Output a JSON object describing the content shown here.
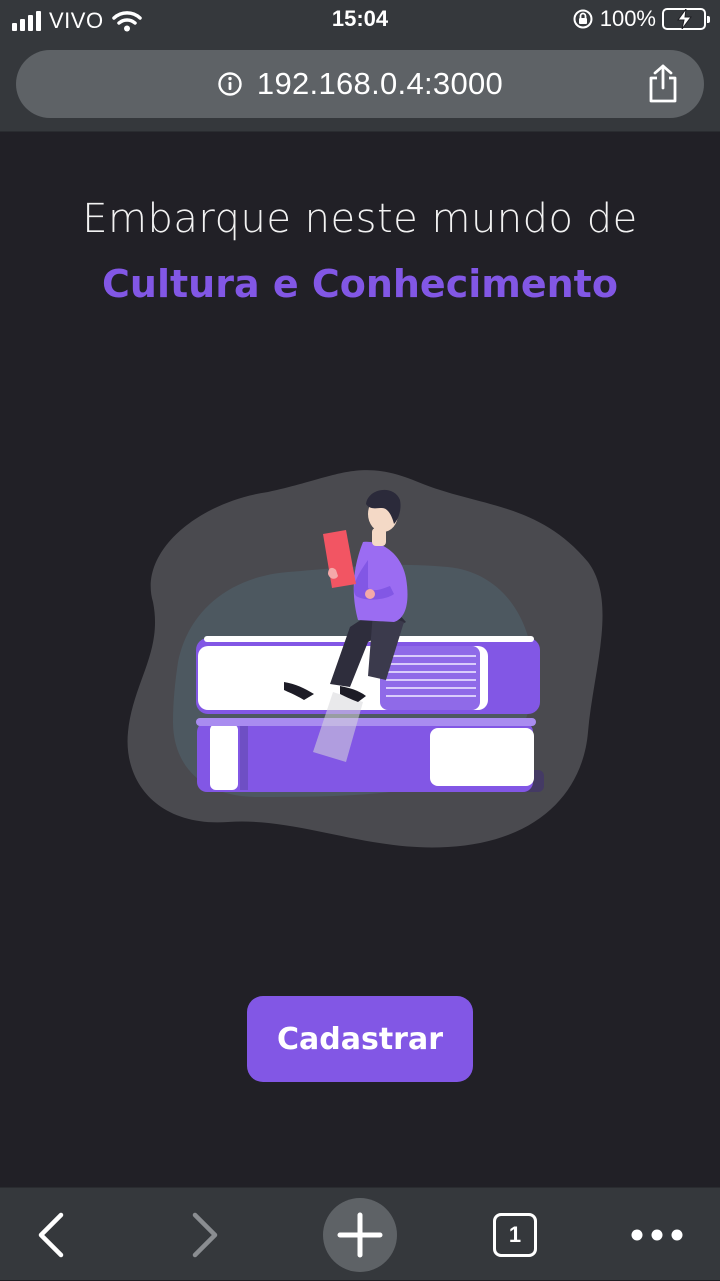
{
  "status_bar": {
    "carrier": "VIVO",
    "time": "15:04",
    "battery_percent": "100%",
    "signal_bars": 4,
    "icons": [
      "signal-icon",
      "wifi-icon",
      "orientation-lock-icon",
      "battery-charging-icon"
    ]
  },
  "browser": {
    "url": "192.168.0.4:3000",
    "url_icon": "info-icon",
    "share_icon": "share-icon",
    "tabs_count": "1",
    "toolbar_icons": [
      "back-icon",
      "forward-icon",
      "plus-icon",
      "tabs-icon",
      "more-icon"
    ]
  },
  "page": {
    "headline": "Embarque neste mundo de",
    "highlight": "Cultura e Conhecimento",
    "cta_label": "Cadastrar",
    "illustration": "person-reading-on-books-illustration"
  },
  "colors": {
    "background": "#212026",
    "accent": "#8257e5",
    "chrome": "#35383c",
    "battery": "#34c759"
  }
}
